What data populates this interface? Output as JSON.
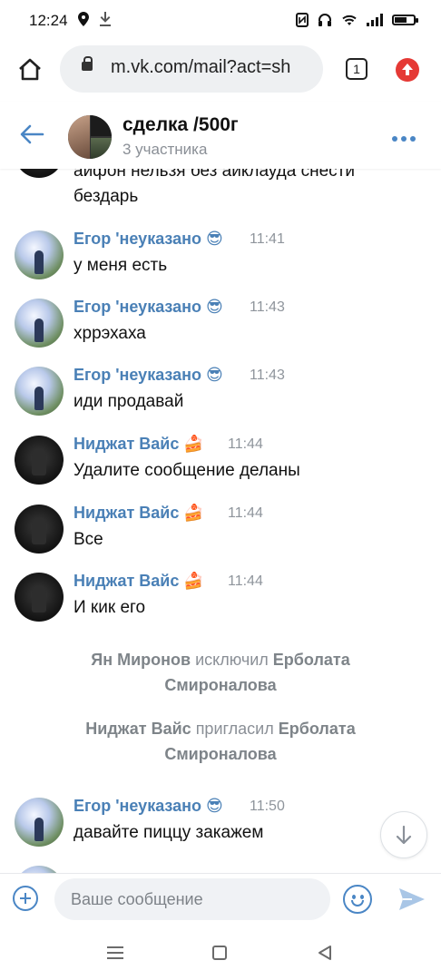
{
  "status": {
    "time": "12:24",
    "left_icons": [
      "location-icon",
      "download-icon"
    ],
    "right_icons": [
      "nfc-icon",
      "headset-icon",
      "wifi-icon",
      "signal-icon",
      "battery-icon"
    ]
  },
  "browser": {
    "url": "m.vk.com/mail?act=sh",
    "tab_count": "1"
  },
  "chat": {
    "title": "сделка /500г",
    "subtitle": "3 участника"
  },
  "partial_message": {
    "line1": "айфон нельзя без айклауда снести",
    "line2": "бездарь"
  },
  "messages": [
    {
      "author": "Егор 'неуказано",
      "emoji": "😎",
      "time": "11:41",
      "text": "у меня есть",
      "avatar": "egor"
    },
    {
      "author": "Егор 'неуказано",
      "emoji": "😎",
      "time": "11:43",
      "text": "хррэхаха",
      "avatar": "egor"
    },
    {
      "author": "Егор 'неуказано",
      "emoji": "😎",
      "time": "11:43",
      "text": "иди продавай",
      "avatar": "egor"
    },
    {
      "author": "Ниджат Вайс",
      "emoji": "🍰",
      "time": "11:44",
      "text": "Удалите сообщение деланы",
      "avatar": "nijat"
    },
    {
      "author": "Ниджат Вайс",
      "emoji": "🍰",
      "time": "11:44",
      "text": "Все",
      "avatar": "nijat"
    },
    {
      "author": "Ниджат Вайс",
      "emoji": "🍰",
      "time": "11:44",
      "text": "И кик его",
      "avatar": "nijat"
    }
  ],
  "system_events": [
    {
      "actor": "Ян Миронов",
      "action": "исключил",
      "target_line1": "Ерболата",
      "target_line2": "Смироналова"
    },
    {
      "actor": "Ниджат Вайс",
      "action": "пригласил",
      "target_line1": "Ерболата",
      "target_line2": "Смироналова"
    }
  ],
  "last_message": {
    "author": "Егор 'неуказано",
    "emoji": "😎",
    "time": "11:50",
    "text": "давайте пиццу закажем",
    "avatar": "egor"
  },
  "composer": {
    "placeholder": "Ваше сообщение"
  }
}
